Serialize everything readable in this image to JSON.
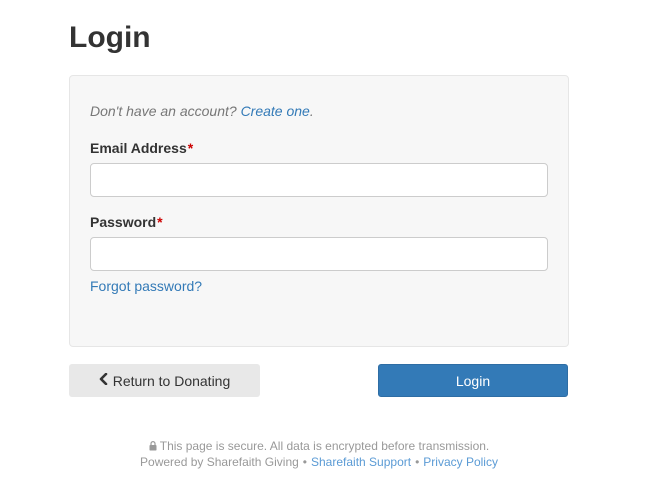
{
  "page": {
    "title": "Login"
  },
  "panel": {
    "account_prompt": "Don't have an account?",
    "create_link": "Create one",
    "create_suffix": ".",
    "email_label": "Email Address",
    "password_label": "Password",
    "required_mark": "*",
    "email_value": "",
    "password_value": "",
    "forgot_link": "Forgot password?"
  },
  "actions": {
    "return_label": "Return to Donating",
    "return_icon": "chevron-left-icon",
    "login_label": "Login"
  },
  "footer": {
    "secure_icon": "lock-icon",
    "secure_text": "This page is secure. All data is encrypted before transmission.",
    "powered_text": "Powered by Sharefaith Giving",
    "separator": "•",
    "support_link": "Sharefaith Support",
    "privacy_link": "Privacy Policy"
  },
  "colors": {
    "accent": "#337ab7",
    "required": "#cc0000",
    "panel_bg": "#f7f7f7"
  }
}
